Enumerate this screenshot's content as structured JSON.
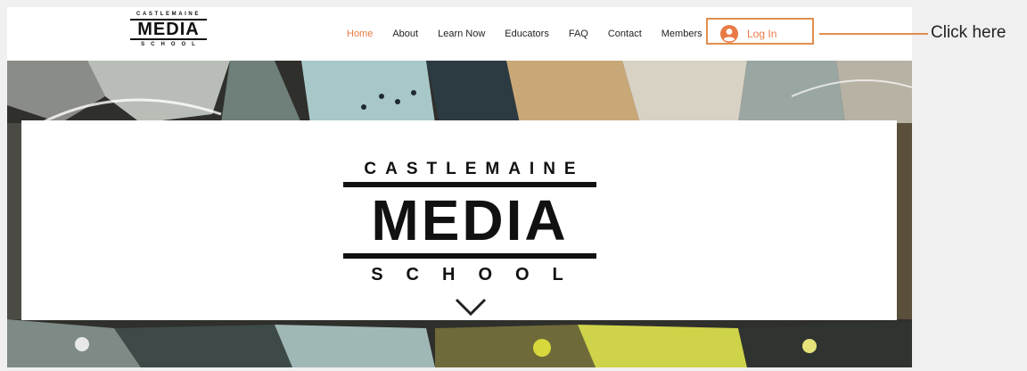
{
  "brand": {
    "top": "CASTLEMAINE",
    "main": "MEDIA",
    "bottom": "SCHOOL"
  },
  "nav": {
    "items": [
      {
        "label": "Home",
        "active": true
      },
      {
        "label": "About"
      },
      {
        "label": "Learn Now"
      },
      {
        "label": "Educators"
      },
      {
        "label": "FAQ"
      },
      {
        "label": "Contact"
      },
      {
        "label": "Members"
      }
    ],
    "login_label": "Log In",
    "login_icon": "user-avatar-icon"
  },
  "hero_logo": {
    "top": "CASTLEMAINE",
    "main": "MEDIA",
    "bottom": "SCHOOL"
  },
  "scroll_icon": "chevron-down-icon",
  "annotation": {
    "text": "Click here"
  },
  "colors": {
    "accent": "#e87a45",
    "highlight_border": "#e28e4f"
  }
}
